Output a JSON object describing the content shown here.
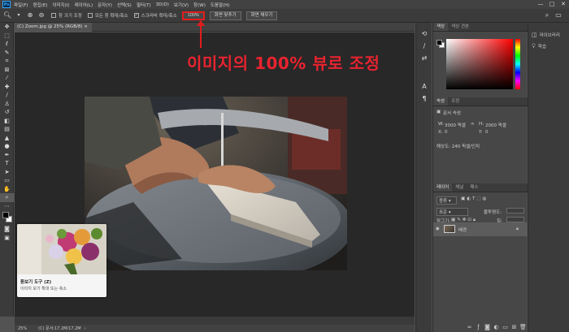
{
  "menubar": {
    "logo": "Ps",
    "items": [
      "파일(F)",
      "편집(E)",
      "이미지(I)",
      "레이어(L)",
      "문자(Y)",
      "선택(S)",
      "필터(T)",
      "3D(D)",
      "보기(V)",
      "창(W)",
      "도움말(H)"
    ],
    "window_controls": [
      "—",
      "□",
      "✕"
    ]
  },
  "options": {
    "tool_icon": "zoom-icon",
    "checks": [
      {
        "label": "창 크기 조정",
        "checked": false
      },
      {
        "label": "모든 창 확대/축소",
        "checked": false
      },
      {
        "label": "스크러비 확대/축소",
        "checked": true
      }
    ],
    "zoom_button": "100%",
    "fit_button": "화면 맞추기",
    "fill_button": "화면 채우기"
  },
  "annotation": {
    "text": "이미지의 100% 뷰로 조정",
    "color": "#e21d1d"
  },
  "document": {
    "tab_title": "(C) Zoom.jpg @ 25% (RGB/8)"
  },
  "tooltip": {
    "title": "돋보기 도구 (Z)",
    "desc": "이미지 보기 확대 또는 축소"
  },
  "status": {
    "zoom": "25%",
    "doc": "(C) 문서:17.2M/17.2M"
  },
  "panels": {
    "color_tabs": [
      "색상",
      "색상 견본"
    ],
    "props_tabs": [
      "속성",
      "조정"
    ],
    "props_heading": "문서 속성",
    "props_w_label": "W:",
    "props_w": "3000 픽셀",
    "props_h_label": "H:",
    "props_h": "2000 픽셀",
    "props_x_label": "X:",
    "props_x": "0",
    "props_y_label": "Y:",
    "props_y": "0",
    "props_res": "해상도: 240 픽셀/인치",
    "layer_tabs": [
      "레이어",
      "채널",
      "패스"
    ],
    "layer_kind": "종류",
    "layer_mode": "표준",
    "opacity_label": "불투명도:",
    "fill_label": "칠:",
    "lock_label": "잠그기:",
    "layer_name": "배경"
  },
  "farright": {
    "items": [
      {
        "icon": "learn-icon",
        "label": "라이브러리"
      },
      {
        "icon": "lightbulb-icon",
        "label": "학습"
      }
    ]
  },
  "colors": {
    "foreground": "#000000",
    "background": "#ffffff",
    "accent": "#e21d1d"
  }
}
